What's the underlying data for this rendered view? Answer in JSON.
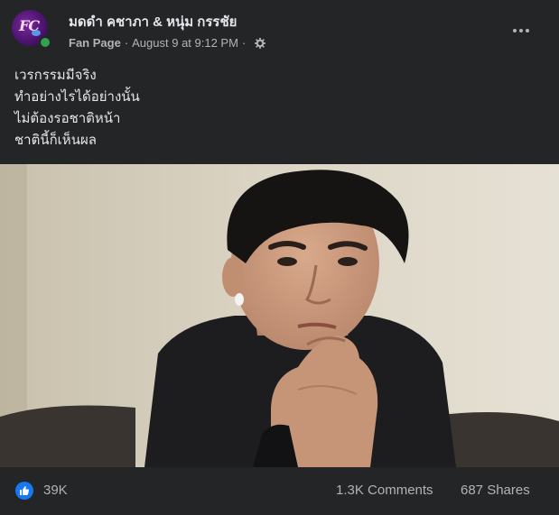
{
  "post": {
    "author_name": "มดดำ คชาภา & หนุ่ม กรรชัย",
    "avatar_text": "FC",
    "author_type": "Fan Page",
    "separator": "·",
    "timestamp": "August 9 at 9:12 PM",
    "separator2": "·",
    "audience_icon": "gear-icon",
    "more_icon": "more-options-icon",
    "text_lines": [
      "เวรกรรมมีจริง",
      "ทำอย่างไรได้อย่างนั้น",
      "ไม่ต้องรอชาติหน้า",
      "ชาตินี้ก็เห็นผล"
    ],
    "media_icon": "video-thumbnail"
  },
  "stats": {
    "reaction_icon": "like-icon",
    "reactions": "39K",
    "comments": "1.3K Comments",
    "shares": "687 Shares"
  },
  "colors": {
    "background": "#242526",
    "text_primary": "#e4e6eb",
    "text_secondary": "#b0b3b8",
    "accent_like": "#1877f2",
    "online": "#31a24c"
  }
}
